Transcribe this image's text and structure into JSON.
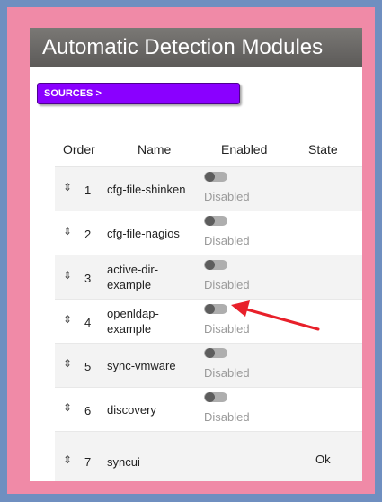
{
  "header": {
    "title": "Automatic Detection Modules"
  },
  "sources_button": {
    "label": "SOURCES >"
  },
  "table": {
    "columns": {
      "order": "Order",
      "name": "Name",
      "enabled": "Enabled",
      "state": "State"
    },
    "rows": [
      {
        "order": "1",
        "name": "cfg-file-shinken",
        "enabled_label": "Disabled",
        "state": ""
      },
      {
        "order": "2",
        "name": "cfg-file-nagios",
        "enabled_label": "Disabled",
        "state": ""
      },
      {
        "order": "3",
        "name": "active-dir-example",
        "enabled_label": "Disabled",
        "state": ""
      },
      {
        "order": "4",
        "name": "openldap-example",
        "enabled_label": "Disabled",
        "state": ""
      },
      {
        "order": "5",
        "name": "sync-vmware",
        "enabled_label": "Disabled",
        "state": ""
      },
      {
        "order": "6",
        "name": "discovery",
        "enabled_label": "Disabled",
        "state": ""
      },
      {
        "order": "7",
        "name": "syncui",
        "enabled_label": "",
        "state": "Ok"
      }
    ]
  },
  "icons": {
    "drag_handle": "drag-handle-icon",
    "toggle": "toggle-switch"
  },
  "colors": {
    "accent": "#8a00ff",
    "frame": "#f08aa7",
    "background": "#6f8fc0",
    "arrow": "#e8202a"
  }
}
